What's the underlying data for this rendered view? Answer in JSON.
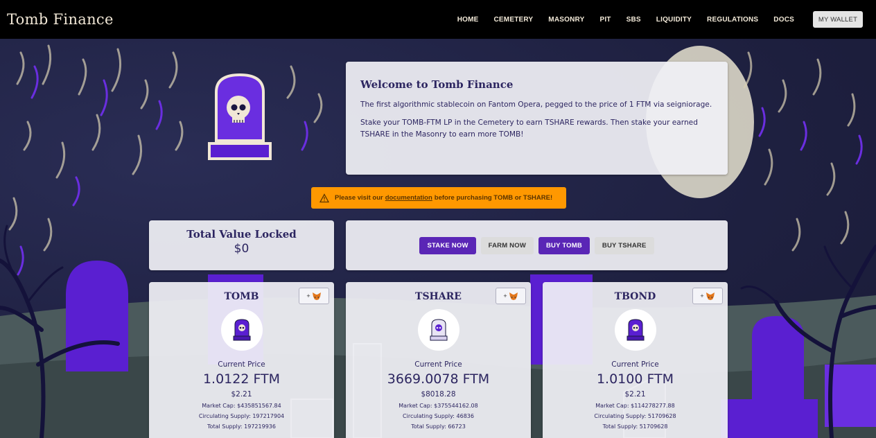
{
  "navbar": {
    "brand": "Tomb Finance",
    "links": [
      "HOME",
      "CEMETERY",
      "MASONRY",
      "PIT",
      "SBS",
      "LIQUIDITY",
      "REGULATIONS",
      "DOCS"
    ],
    "wallet_label": "MY WALLET"
  },
  "welcome": {
    "title": "Welcome to Tomb Finance",
    "p1": "The first algorithmic stablecoin on Fantom Opera, pegged to the price of 1 FTM via seigniorage.",
    "p2": "Stake your TOMB-FTM LP in the Cemetery to earn TSHARE rewards. Then stake your earned TSHARE in the Masonry to earn more TOMB!"
  },
  "alert": {
    "pre": "Please visit our",
    "link": "documentation",
    "post": "before purchasing TOMB or TSHARE!"
  },
  "tvl": {
    "title": "Total Value Locked",
    "value": "$0"
  },
  "actions": {
    "stake_now": "STAKE NOW",
    "farm_now": "FARM NOW",
    "buy_tomb": "BUY TOMB",
    "buy_tshare": "BUY TSHARE"
  },
  "colors": {
    "accent": "#5a26b6",
    "alert": "#ff9800",
    "text": "#2c2560"
  },
  "tokens": [
    {
      "name": "TOMB",
      "add_label": "+",
      "price_label": "Current Price",
      "price": "1.0122 FTM",
      "usd": "$2.21",
      "market_cap": "Market Cap: $435851567.84",
      "circulating": "Circulating Supply: 197217904",
      "total": "Total Supply: 197219936"
    },
    {
      "name": "TSHARE",
      "add_label": "+",
      "price_label": "Current Price",
      "price": "3669.0078 FTM",
      "usd": "$8018.28",
      "market_cap": "Market Cap: $375544162.08",
      "circulating": "Circulating Supply: 46836",
      "total": "Total Supply: 66723"
    },
    {
      "name": "TBOND",
      "add_label": "+",
      "price_label": "Current Price",
      "price": "1.0100 FTM",
      "usd": "$2.21",
      "market_cap": "Market Cap: $114278277.88",
      "circulating": "Circulating Supply: 51709628",
      "total": "Total Supply: 51709628"
    }
  ]
}
